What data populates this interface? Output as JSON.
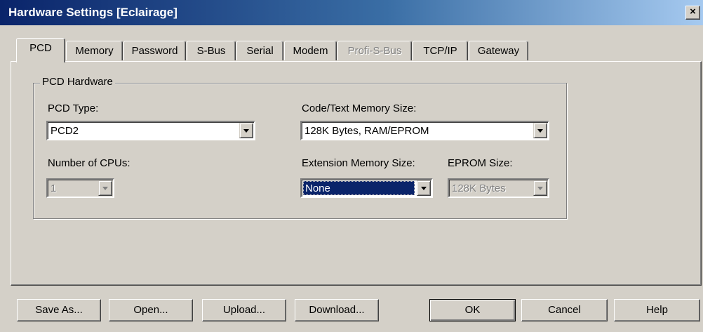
{
  "window": {
    "title": "Hardware Settings [Eclairage]",
    "close_glyph": "×"
  },
  "tabs": [
    {
      "label": "PCD",
      "active": true
    },
    {
      "label": "Memory"
    },
    {
      "label": "Password"
    },
    {
      "label": "S-Bus"
    },
    {
      "label": "Serial"
    },
    {
      "label": "Modem"
    },
    {
      "label": "Profi-S-Bus",
      "disabled": true
    },
    {
      "label": "TCP/IP"
    },
    {
      "label": "Gateway"
    }
  ],
  "pcd_hardware": {
    "group_label": "PCD Hardware",
    "pcd_type": {
      "label": "PCD Type:",
      "value": "PCD2"
    },
    "code_text_memory": {
      "label": "Code/Text Memory Size:",
      "value": "128K Bytes, RAM/EPROM"
    },
    "num_cpus": {
      "label": "Number of CPUs:",
      "value": "1",
      "disabled": true
    },
    "extension_memory": {
      "label": "Extension Memory Size:",
      "value": "None",
      "selected": true
    },
    "eprom_size": {
      "label": "EPROM Size:",
      "value": "128K Bytes",
      "disabled": true
    }
  },
  "buttons": {
    "save_as": "Save As...",
    "open": "Open...",
    "upload": "Upload...",
    "download": "Download...",
    "ok": "OK",
    "cancel": "Cancel",
    "help": "Help"
  },
  "colors": {
    "titlebar_start": "#0a246a",
    "titlebar_end": "#a6caf0",
    "face": "#d4d0c8",
    "selection": "#0a246a"
  }
}
